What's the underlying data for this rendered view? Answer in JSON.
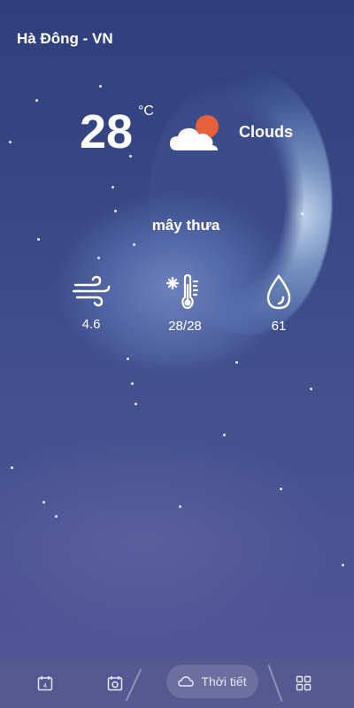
{
  "location": "Hà Đông - VN",
  "temperature": {
    "value": "28",
    "unit": "°C"
  },
  "condition": "Clouds",
  "description": "mây thưa",
  "metrics": {
    "wind": {
      "icon": "wind-icon",
      "value": "4.6"
    },
    "temperature_range": {
      "icon": "thermometer-icon",
      "value": "28/28"
    },
    "humidity": {
      "icon": "water-drop-icon",
      "value": "61"
    }
  },
  "bottom_nav": {
    "calendar": {
      "icon": "calendar-icon",
      "badge": "4"
    },
    "clock": {
      "icon": "alarm-clock-icon"
    },
    "weather": {
      "icon": "cloud-icon",
      "label": "Thời tiết"
    },
    "more": {
      "icon": "grid-icon"
    }
  },
  "colors": {
    "background_top": "#2e3f7c",
    "background_bottom": "#55599a",
    "sun": "#e8603a",
    "text": "#ffffff"
  }
}
